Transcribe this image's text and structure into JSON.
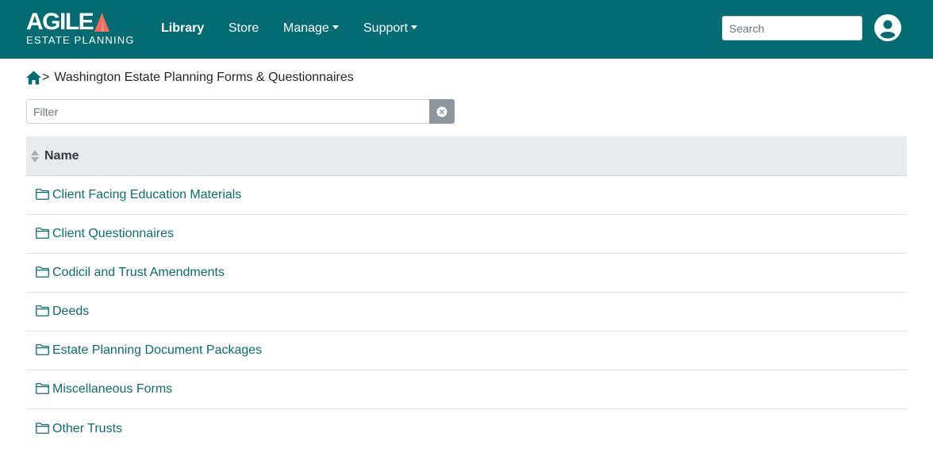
{
  "brand": {
    "name_top": "AGILE",
    "name_bottom": "ESTATE PLANNING",
    "accent_color": "#f06a5e"
  },
  "nav": {
    "library": "Library",
    "store": "Store",
    "manage": "Manage",
    "support": "Support"
  },
  "search": {
    "placeholder": "Search",
    "value": ""
  },
  "breadcrumb": {
    "separator": ">",
    "current": "Washington Estate Planning Forms & Questionnaires"
  },
  "filter": {
    "placeholder": "Filter",
    "value": ""
  },
  "table": {
    "header": "Name",
    "rows": [
      {
        "label": "Client Facing Education Materials",
        "icon": "folder-icon"
      },
      {
        "label": "Client Questionnaires",
        "icon": "folder-icon"
      },
      {
        "label": "Codicil and Trust Amendments",
        "icon": "folder-icon"
      },
      {
        "label": "Deeds",
        "icon": "folder-icon"
      },
      {
        "label": "Estate Planning Document Packages",
        "icon": "folder-icon"
      },
      {
        "label": "Miscellaneous Forms",
        "icon": "folder-icon"
      },
      {
        "label": "Other Trusts",
        "icon": "folder-icon"
      }
    ]
  },
  "colors": {
    "navbar": "#036b72",
    "link": "#0b6b73",
    "header_bg": "#e9ecef"
  }
}
